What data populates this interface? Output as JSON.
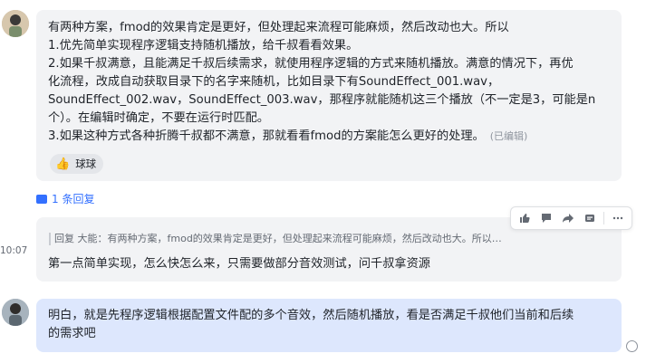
{
  "message1": {
    "lines": [
      "有两种方案，fmod的效果肯定是更好，但处理起来流程可能麻烦，然后改动也大。所以",
      "1.优先简单实现程序逻辑支持随机播放，给千叔看看效果。",
      "2.如果千叔满意，且能满足千叔后续需求，就使用程序逻辑的方式来随机播放。满意的情况下，再优",
      "化流程，改成自动获取目录下的名字来随机，比如目录下有SoundEffect_001.wav，",
      "SoundEffect_002.wav，SoundEffect_003.wav，那程序就能随机这三个播放（不一定是3，可能是n",
      "个）。在编辑时确定，不要在运行时匹配。",
      "3.如果这种方式各种折腾千叔都不满意，那就看看fmod的方案能怎么更好的处理。"
    ],
    "edited_label": "(已编辑)",
    "reaction": {
      "emoji": "👍",
      "name": "球球"
    }
  },
  "replies": {
    "label": "1 条回复"
  },
  "message2": {
    "quote": "回复 大能：有两种方案，fmod的效果肯定是更好，但处理起来流程可能麻烦，然后改动也大。所以1.优先简单实...",
    "body": "第一点简单实现，怎么快怎么来，只需要做部分音效测试，问千叔拿资源"
  },
  "time": "10:07",
  "message3": {
    "lines": [
      "明白，就是先程序逻辑根据配置文件配的多个音效，然后随机播放，看是否满足千叔他们当前和后续",
      "的需求吧"
    ]
  },
  "colors": {
    "accent": "#3370ff",
    "self_bubble": "#dde7fd",
    "other_bubble": "#f2f3f5"
  }
}
